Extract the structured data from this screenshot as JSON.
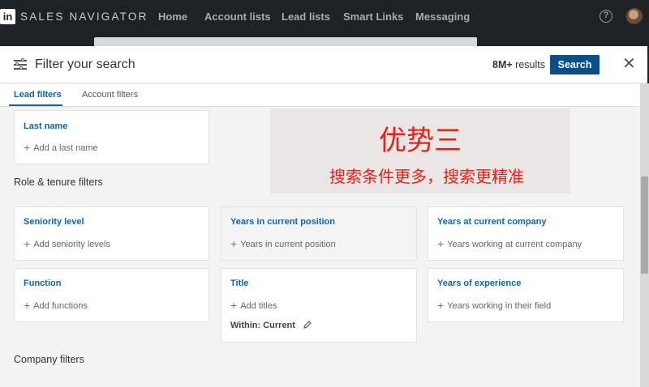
{
  "nav": {
    "logo": "in",
    "brand": "SALES NAVIGATOR",
    "items": [
      "Home",
      "Account lists",
      "Lead lists",
      "Smart Links",
      "Messaging"
    ]
  },
  "modal": {
    "title": "Filter your search",
    "results_count": "8M+",
    "results_label": "results",
    "search_button": "Search",
    "tabs": [
      {
        "label": "Lead filters",
        "active": true
      },
      {
        "label": "Account filters",
        "active": false
      }
    ],
    "sections": {
      "role": "Role & tenure filters",
      "company": "Company filters"
    },
    "cards": {
      "last_name": {
        "title": "Last name",
        "add": "Add a last name"
      },
      "seniority": {
        "title": "Seniority level",
        "add": "Add seniority levels"
      },
      "years_position": {
        "title": "Years in current position",
        "add": "Years in current position"
      },
      "years_company": {
        "title": "Years at current company",
        "add": "Years working at current company"
      },
      "function": {
        "title": "Function",
        "add": "Add functions"
      },
      "title": {
        "title": "Title",
        "add": "Add titles",
        "within": "Within: Current"
      },
      "experience": {
        "title": "Years of experience",
        "add": "Years working in their field"
      }
    }
  },
  "annotation": {
    "title": "优势三",
    "subtitle": "搜索条件更多，搜索更精准"
  },
  "colors": {
    "nav_bg": "#1d2226",
    "accent": "#0a66a8",
    "search_button": "#0a4e85",
    "annotation": "#e8201a"
  }
}
